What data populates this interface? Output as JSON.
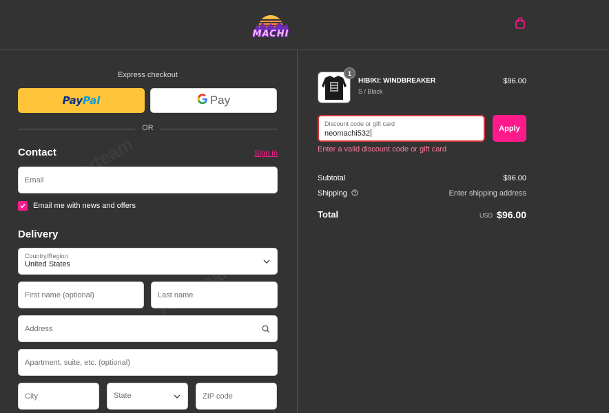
{
  "header": {
    "logo_text": "MACHI",
    "cart_icon": "shopping-bag-icon"
  },
  "express": {
    "label": "Express checkout",
    "paypal_part1": "Pay",
    "paypal_part2": "Pal",
    "gpay_g": "G",
    "gpay_text": "Pay",
    "or_text": "OR"
  },
  "contact": {
    "title": "Contact",
    "signin": "Sign in",
    "email_placeholder": "Email",
    "news_label": "Email me with news and offers",
    "news_checked": true
  },
  "delivery": {
    "title": "Delivery",
    "country_label": "Country/Region",
    "country_value": "United States",
    "first_name_placeholder": "First name (optional)",
    "last_name_placeholder": "Last name",
    "address_placeholder": "Address",
    "apartment_placeholder": "Apartment, suite, etc. (optional)",
    "city_placeholder": "City",
    "state_label": "State",
    "zip_placeholder": "ZIP code"
  },
  "order": {
    "item": {
      "quantity": "1",
      "name": "HIBIKI: WINDBREAKER",
      "variant": "S / Black",
      "price": "$96.00"
    },
    "discount_label": "Discount code or gift card",
    "discount_value": "neomachi532",
    "apply_label": "Apply",
    "error": "Enter a valid discount code or gift card",
    "subtotal_label": "Subtotal",
    "subtotal_value": "$96.00",
    "shipping_label": "Shipping",
    "shipping_value": "Enter shipping address",
    "total_label": "Total",
    "total_currency": "USD",
    "total_value": "$96.00"
  },
  "colors": {
    "background": "#333333",
    "accent": "#ff1a8c",
    "error": "#d8383c",
    "paypal": "#ffc439"
  }
}
